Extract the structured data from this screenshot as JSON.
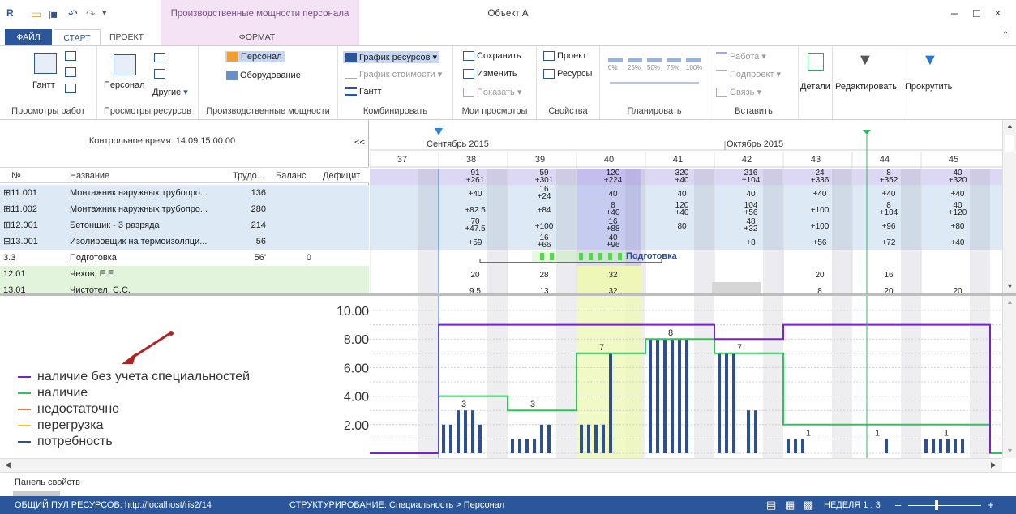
{
  "window": {
    "title": "Объект А",
    "context_title": "Производственные мощности персонала"
  },
  "tabs": {
    "file": "ФАЙЛ",
    "start": "СТАРТ",
    "project": "ПРОЕКТ",
    "format": "ФОРМАТ"
  },
  "ribbon": {
    "work_views": {
      "gantt": "Гантт",
      "label": "Просмотры работ"
    },
    "resource_views": {
      "personnel": "Персонал",
      "other": "Другие",
      "label": "Просмотры ресурсов"
    },
    "capacities": {
      "personnel": "Персонал",
      "equipment": "Оборудование",
      "label": "Производственные мощности"
    },
    "combine": {
      "resource_chart": "График ресурсов",
      "cost_chart": "График стоимости",
      "gantt": "Гантт",
      "label": "Комбинировать"
    },
    "my_views": {
      "save": "Сохранить",
      "change": "Изменить",
      "show": "Показать",
      "label": "Мои просмотры"
    },
    "properties": {
      "project": "Проект",
      "resources": "Ресурсы",
      "label": "Свойства"
    },
    "plan": {
      "pcts": [
        "0%",
        "25%",
        "50%",
        "75%",
        "100%"
      ],
      "label": "Планировать"
    },
    "insert": {
      "work": "Работа",
      "subproject": "Подпроект",
      "link": "Связь",
      "label": "Вставить"
    },
    "details": "Детали",
    "edit": "Редактировать",
    "scroll": "Прокрутить"
  },
  "leftpane": {
    "control_time": "Контрольное время: 14.09.15 00:00",
    "collapse": "<<",
    "columns": {
      "no": "№",
      "name": "Название",
      "labor": "Трудо...",
      "balance": "Баланс",
      "deficit": "Дефицит"
    },
    "rows": [
      {
        "no": "⊞11.001",
        "name": "Монтажник наружных трубопро...",
        "labor": "136",
        "balance": "",
        "deficit": "",
        "bg": "#dde9f5"
      },
      {
        "no": "⊞11.002",
        "name": "Монтажник наружных трубопро...",
        "labor": "280",
        "balance": "",
        "deficit": "",
        "bg": "#dde9f5"
      },
      {
        "no": "⊞12.001",
        "name": "Бетонщик - 3 разряда",
        "labor": "214",
        "balance": "",
        "deficit": "",
        "bg": "#dde9f5"
      },
      {
        "no": "⊟13.001",
        "name": "Изолировщик на термоизоляци...",
        "labor": "56",
        "balance": "",
        "deficit": "",
        "bg": "#dde9f5"
      },
      {
        "no": "3.3",
        "name": "Подготовка",
        "labor": "56'",
        "balance": "0",
        "deficit": "",
        "bg": "#ffffff"
      },
      {
        "no": "12.01",
        "name": "Чехов, Е.Е.",
        "labor": "",
        "balance": "",
        "deficit": "",
        "bg": "#e2f5dc"
      },
      {
        "no": "13.01",
        "name": "Чистотел, С.С.",
        "labor": "",
        "balance": "",
        "deficit": "",
        "bg": "#e2f5dc"
      }
    ]
  },
  "timeline": {
    "months": [
      "Сентябрь 2015",
      "Октябрь 2015"
    ],
    "weeks": [
      "37",
      "38",
      "39",
      "40",
      "41",
      "42",
      "43",
      "44",
      "45"
    ],
    "total_row": [
      [
        "",
        ""
      ],
      [
        "91",
        "+261"
      ],
      [
        "59",
        "+301"
      ],
      [
        "120",
        "+224"
      ],
      [
        "320",
        "+40"
      ],
      [
        "216",
        "+104"
      ],
      [
        "24",
        "+336"
      ],
      [
        "8",
        "+352"
      ],
      [
        "40",
        "+320"
      ]
    ],
    "rows": [
      [
        [
          "",
          ""
        ],
        [
          "",
          "+40"
        ],
        [
          "16",
          "+24"
        ],
        [
          "",
          "40"
        ],
        [
          "",
          "40"
        ],
        [
          "",
          "40"
        ],
        [
          "",
          "+40"
        ],
        [
          "",
          "+40"
        ],
        [
          "",
          "+40"
        ]
      ],
      [
        [
          "",
          ""
        ],
        [
          "",
          "+82.5"
        ],
        [
          "",
          "+84"
        ],
        [
          "8",
          "+40"
        ],
        [
          "120",
          "+40"
        ],
        [
          "104",
          "+56"
        ],
        [
          "",
          "+100"
        ],
        [
          "8",
          "+104"
        ],
        [
          "40",
          "+120"
        ]
      ],
      [
        [
          "",
          ""
        ],
        [
          "70",
          "+47.5"
        ],
        [
          "",
          "+100"
        ],
        [
          "16",
          "+88"
        ],
        [
          "",
          "80"
        ],
        [
          "48",
          "+32"
        ],
        [
          "",
          "+100"
        ],
        [
          "",
          "+96"
        ],
        [
          "",
          "+80"
        ]
      ],
      [
        [
          "",
          ""
        ],
        [
          "",
          "+59"
        ],
        [
          "16",
          "+66"
        ],
        [
          "40",
          "+96"
        ],
        [
          "",
          ""
        ],
        [
          "",
          "+8"
        ],
        [
          "",
          "+56"
        ],
        [
          "",
          "+72"
        ],
        [
          "",
          "+40"
        ]
      ],
      [
        [
          "",
          ""
        ],
        [
          "",
          ""
        ],
        [
          "",
          ""
        ],
        [
          "",
          ""
        ],
        [
          "",
          ""
        ],
        [
          "",
          ""
        ],
        [
          "",
          ""
        ],
        [
          "",
          ""
        ],
        [
          "",
          ""
        ]
      ],
      [
        [
          "",
          ""
        ],
        [
          "",
          "20"
        ],
        [
          "",
          "28"
        ],
        [
          "",
          "32"
        ],
        [
          "",
          ""
        ],
        [
          "",
          ""
        ],
        [
          "",
          "20"
        ],
        [
          "",
          "16"
        ],
        [
          "",
          ""
        ]
      ],
      [
        [
          "",
          ""
        ],
        [
          "",
          "9.5"
        ],
        [
          "",
          "13"
        ],
        [
          "",
          "32"
        ],
        [
          "",
          ""
        ],
        [
          "",
          ""
        ],
        [
          "",
          "8"
        ],
        [
          "",
          "20"
        ],
        [
          "",
          "20"
        ]
      ]
    ],
    "task_label": "Подготовка"
  },
  "chart_data": {
    "type": "bar",
    "y_ticks": [
      "10.00",
      "8.00",
      "6.00",
      "4.00",
      "2.00"
    ],
    "ylim": [
      0,
      10.5
    ],
    "legend": [
      {
        "label": "наличие без учета специальностей",
        "color": "#7a1fd1"
      },
      {
        "label": "наличие",
        "color": "#2fc45a"
      },
      {
        "label": "недостаточно",
        "color": "#f07a4a"
      },
      {
        "label": "перегрузка",
        "color": "#f2c12b"
      },
      {
        "label": "потребность",
        "color": "#2f4f8f"
      }
    ],
    "value_labels": [
      "3",
      "3",
      "7",
      "8",
      "7",
      "1",
      "1",
      "1"
    ],
    "demand_bars": [
      {
        "week": 38,
        "values": [
          2,
          2,
          3,
          3,
          3,
          2
        ]
      },
      {
        "week": 39,
        "values": [
          1,
          1,
          1,
          1,
          2,
          2
        ]
      },
      {
        "week": 40,
        "values": [
          2,
          2,
          2,
          2,
          7,
          0
        ]
      },
      {
        "week": 41,
        "values": [
          8,
          8,
          8,
          8,
          8,
          8
        ]
      },
      {
        "week": 42,
        "values": [
          7,
          7,
          7,
          0,
          3,
          3
        ]
      },
      {
        "week": 43,
        "values": [
          1,
          1,
          1,
          0,
          0,
          0
        ]
      },
      {
        "week": 44,
        "values": [
          0,
          0,
          0,
          0,
          1,
          0
        ]
      },
      {
        "week": 45,
        "values": [
          1,
          1,
          1,
          1,
          1,
          1
        ]
      }
    ]
  },
  "propbar": {
    "label": "Панель свойств"
  },
  "status": {
    "pool": "ОБЩИЙ ПУЛ РЕСУРСОВ: http://localhost/ris2/14",
    "structure": "СТРУКТУРИРОВАНИЕ: Специальность > Персонал",
    "zoom": "НЕДЕЛЯ 1 : 3"
  }
}
